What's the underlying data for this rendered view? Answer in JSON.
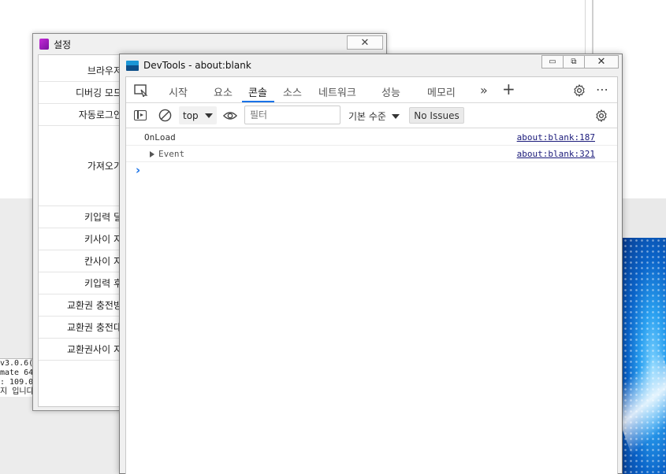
{
  "background": {
    "left_text_lines": [
      "v3.0.6(",
      "mate 64",
      ": 109.0",
      "지 입니다"
    ],
    "accent_blue": "#0a63c8"
  },
  "settings_window": {
    "title": "설정",
    "close_icon": "close-icon",
    "rows": [
      "브라우저",
      "디버깅 모드",
      "자동로그인",
      "가져오기",
      "키입력 딜",
      "키사이 지",
      "칸사이 지",
      "키입력 후",
      "교환권 충전방",
      "교환권 충전대",
      "교환권사이 지"
    ]
  },
  "devtools": {
    "title": "DevTools - about:blank",
    "window_buttons": [
      "minimize-icon",
      "restore-icon",
      "close-icon"
    ],
    "tabs": [
      {
        "label": "시작"
      },
      {
        "label": "요소"
      },
      {
        "label": "콘솔"
      },
      {
        "label": "소스"
      },
      {
        "label": "네트워크"
      },
      {
        "label": "성능"
      },
      {
        "label": "메모리"
      }
    ],
    "active_tab": "콘솔",
    "more_tabs": "»",
    "add_tab": "+",
    "more_options": "⋯",
    "toolbar": {
      "context": "top",
      "filter_placeholder": "필터",
      "level": "기본 수준",
      "issues": "No Issues"
    },
    "console": {
      "entries": [
        {
          "text": "OnLoad",
          "source": "about:blank:187",
          "expandable": false
        },
        {
          "text": "Event",
          "source": "about:blank:321",
          "expandable": true
        }
      ],
      "prompt": "›"
    },
    "accent": "#1a73e8"
  }
}
